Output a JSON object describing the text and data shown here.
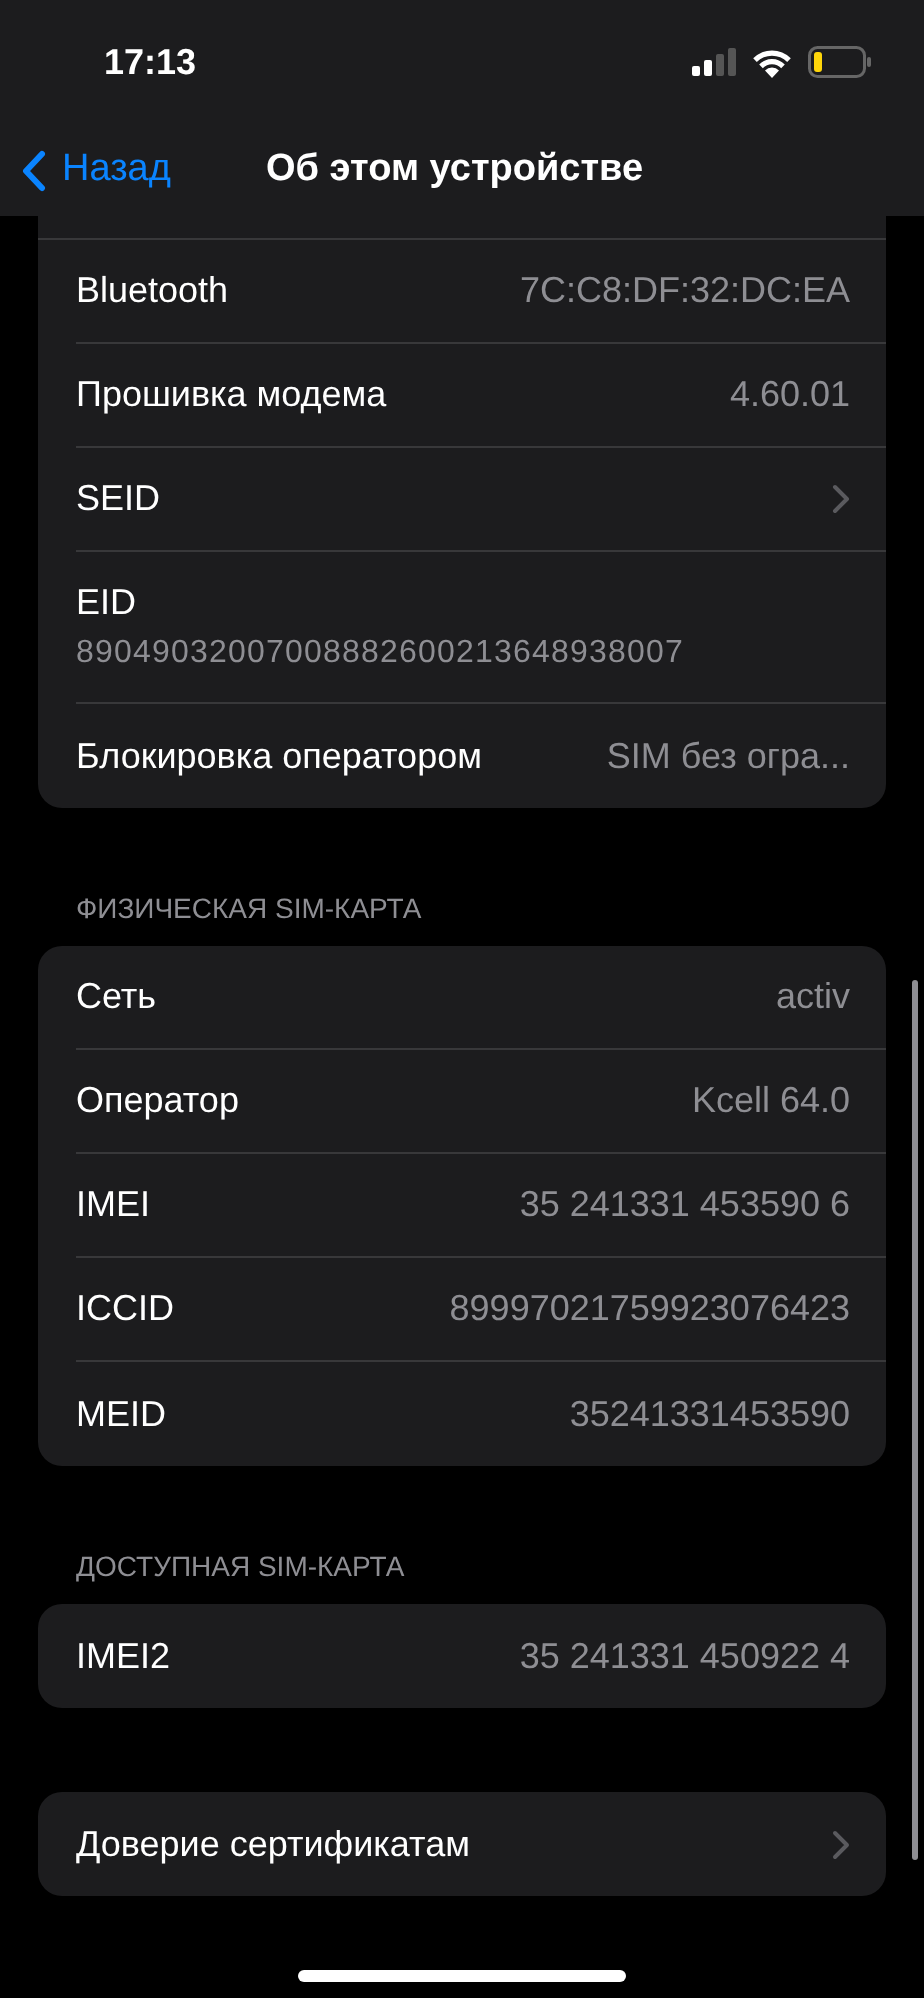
{
  "status_bar": {
    "time": "17:13"
  },
  "nav": {
    "back": "Назад",
    "title": "Об этом устройстве"
  },
  "groups": [
    {
      "rows": [
        {
          "kind": "value",
          "label": "Bluetooth",
          "value": "7C:C8:DF:32:DC:EA"
        },
        {
          "kind": "value",
          "label": "Прошивка модема",
          "value": "4.60.01"
        },
        {
          "kind": "link",
          "label": "SEID"
        },
        {
          "kind": "stacked",
          "label": "EID",
          "value": "89049032007008882600213648938007"
        },
        {
          "kind": "value",
          "label": "Блокировка оператором",
          "value": "SIM без огра..."
        }
      ]
    },
    {
      "header": "ФИЗИЧЕСКАЯ SIM-КАРТА",
      "rows": [
        {
          "kind": "value",
          "label": "Сеть",
          "value": "activ"
        },
        {
          "kind": "value",
          "label": "Оператор",
          "value": "Kcell 64.0"
        },
        {
          "kind": "value",
          "label": "IMEI",
          "value": "35 241331 453590 6"
        },
        {
          "kind": "value",
          "label": "ICCID",
          "value": "89997021759923076423"
        },
        {
          "kind": "value",
          "label": "MEID",
          "value": "35241331453590"
        }
      ]
    },
    {
      "header": "ДОСТУПНАЯ SIM-КАРТА",
      "rows": [
        {
          "kind": "value",
          "label": "IMEI2",
          "value": "35 241331 450922 4"
        }
      ]
    },
    {
      "rows": [
        {
          "kind": "link",
          "label": "Доверие сертификатам"
        }
      ]
    }
  ]
}
